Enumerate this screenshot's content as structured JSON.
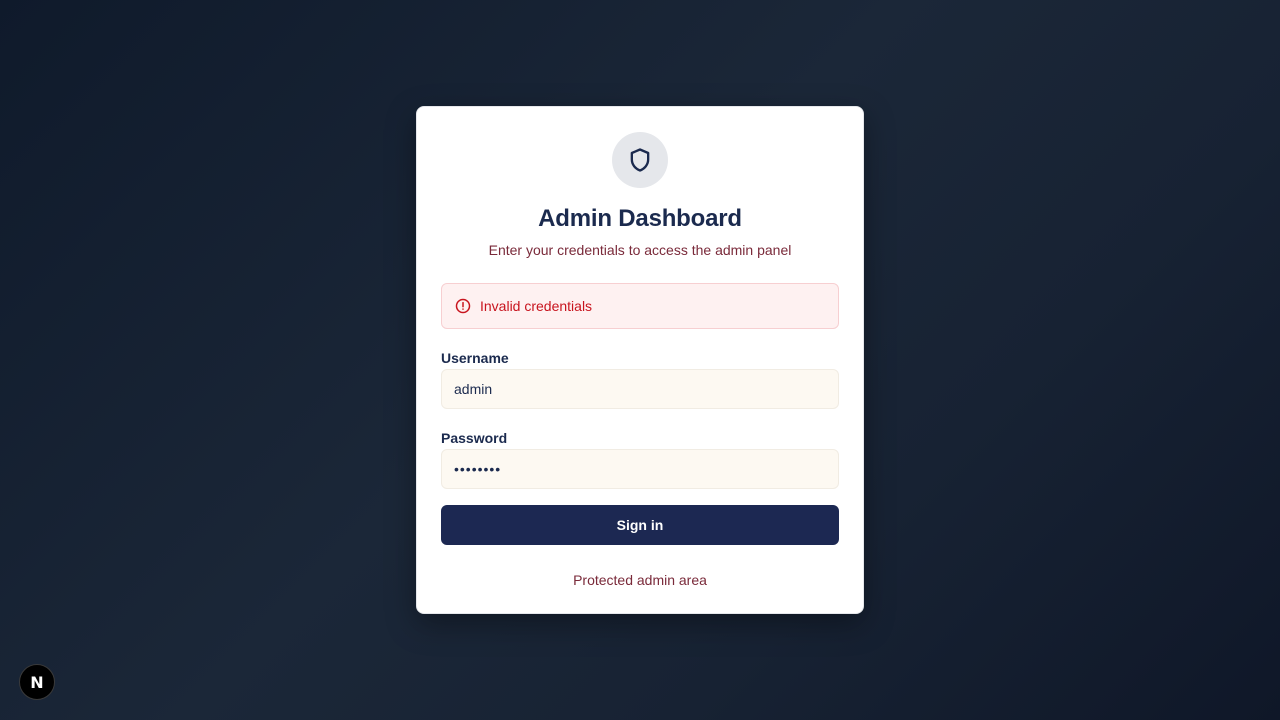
{
  "login_card": {
    "title": "Admin Dashboard",
    "subtitle": "Enter your credentials to access the admin panel",
    "header_icon": "shield-icon",
    "error": {
      "icon": "alert-circle-icon",
      "message": "Invalid credentials"
    },
    "username": {
      "label": "Username",
      "value": "admin"
    },
    "password": {
      "label": "Password",
      "masked_value": "••••••••"
    },
    "submit_label": "Sign in",
    "footer_text": "Protected admin area"
  },
  "dev_badge": {
    "label": "N"
  },
  "colors": {
    "primary": "#1c2852",
    "title": "#1b2a4e",
    "muted_text": "#7a2a3a",
    "error_text": "#c8141e",
    "error_bg": "#fef1f1",
    "input_bg": "#fdf9f2"
  }
}
